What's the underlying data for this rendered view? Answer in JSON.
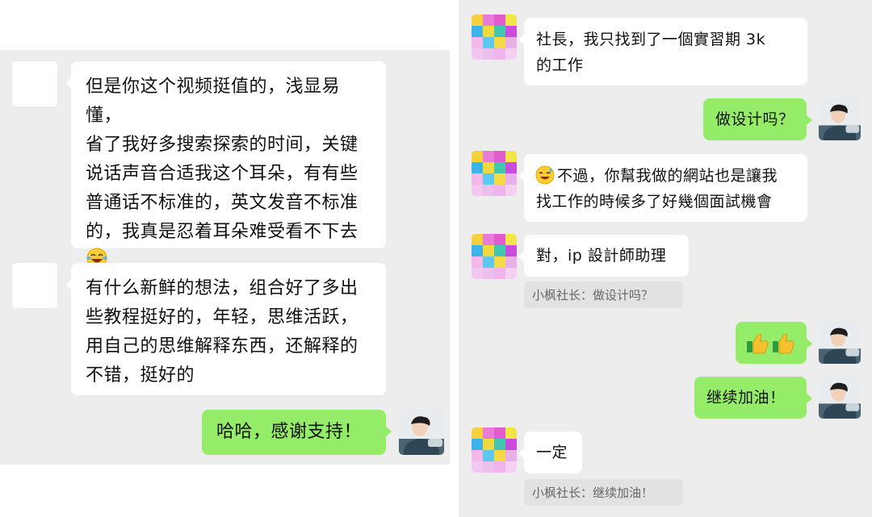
{
  "left_chat": {
    "messages": [
      {
        "sender": "other",
        "text": "但是你这个视频挺值的，浅显易懂，\n省了我好多搜索探索的时间，关键\n说话声音合适我这个耳朵，有有些\n普通话不标准的，英文发音不标准\n的，我真是忍着耳朵难受看不下去",
        "emoji": "laughing-crying-emoji"
      },
      {
        "sender": "other",
        "text": "有什么新鲜的想法，组合好了多出\n些教程挺好的，年轻，思维活跃，\n用自己的思维解释东西，还解释的\n不错，挺好的"
      },
      {
        "sender": "me",
        "text": "哈哈，感谢支持！"
      }
    ]
  },
  "right_chat": {
    "messages": [
      {
        "sender": "other",
        "text": "社長，我只找到了一個實習期 3k\n的工作"
      },
      {
        "sender": "me",
        "text": "做设计吗？"
      },
      {
        "sender": "other",
        "text": "不過，你幫我做的網站也是讓我\n找工作的時候多了好幾個面試機會",
        "emoji": "sweat-smile-emoji"
      },
      {
        "sender": "other",
        "text": "對，ip 設計師助理",
        "quote": "小枫社长：做设计吗？"
      },
      {
        "sender": "me",
        "text": "",
        "emoji": "thumbs-up-emoji x2"
      },
      {
        "sender": "me",
        "text": "继续加油！"
      },
      {
        "sender": "other",
        "text": "一定",
        "quote": "小枫社长：继续加油！"
      }
    ]
  },
  "colors": {
    "chat_background": "#ededed",
    "incoming_bubble": "#ffffff",
    "outgoing_bubble": "#95ec69",
    "quote_background": "#e2e2e2"
  }
}
